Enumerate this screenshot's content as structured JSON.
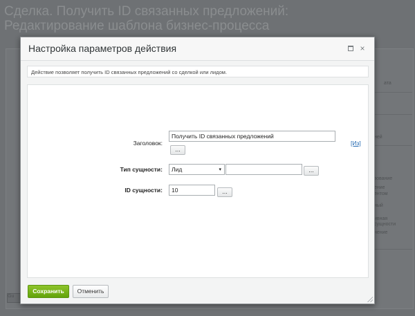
{
  "background": {
    "page_title": "Сделка. Получить ID связанных предложений: Редактирование шаблона бизнес-процесса",
    "right_fragments": [
      "ата",
      "ней",
      "зование",
      "ение",
      "ентом",
      "ный",
      "ивная",
      "сущности",
      "нение"
    ],
    "bottom_left_button": "Gu"
  },
  "dialog": {
    "title": "Настройка параметров действия",
    "maximize_label": "□",
    "close_label": "×",
    "info_text": "Действие позволяет получить ID связанных предложений со сделкой или лидом.",
    "fields": {
      "title_label": "Заголовок:",
      "title_value": "Получить ID связанных предложений",
      "title_dots": "...",
      "title_link": "[Из]",
      "entity_type_label": "Тип сущности:",
      "entity_type_value": "Лид",
      "entity_type_arrow": "▾",
      "entity_type_extra": "",
      "entity_type_dots": "...",
      "entity_id_label": "ID сущности:",
      "entity_id_value": "10",
      "entity_id_dots": "..."
    },
    "save_label": "Сохранить",
    "cancel_label": "Отменить"
  },
  "colors": {
    "overlay": "#6e7174",
    "save_button": "#7ab51d",
    "link": "#2067b0"
  }
}
